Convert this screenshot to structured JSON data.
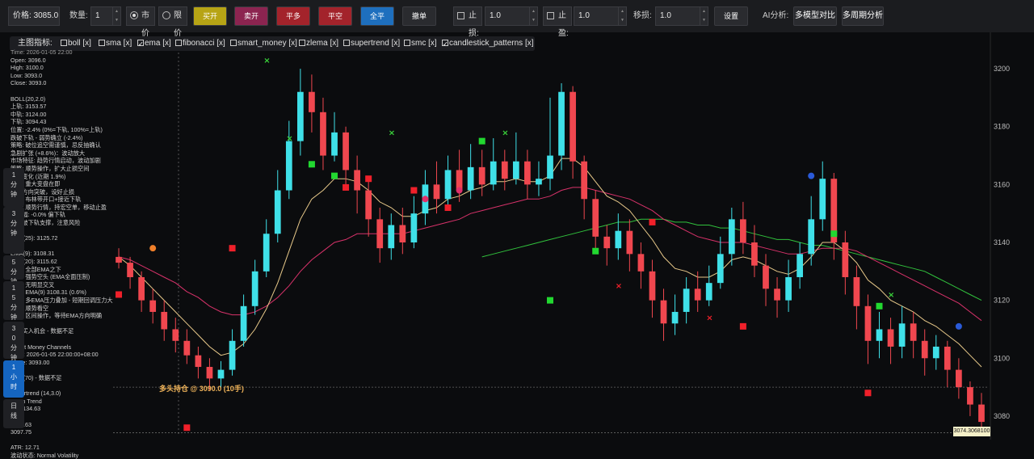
{
  "toolbar": {
    "price_label": "价格:",
    "price_value": "3085.0",
    "qty_label": "数量:",
    "qty_value": "1",
    "market_label": "市价",
    "limit_label": "限价",
    "buy_open": "买开",
    "sell_open": "卖开",
    "close_long": "平多",
    "close_short": "平空",
    "close_all": "全平",
    "withdraw": "撤单",
    "stop_loss_label": "止损:",
    "stop_loss_value": "1.0",
    "take_profit_label": "止盈:",
    "take_profit_value": "1.0",
    "trailing_label": "移损:",
    "trailing_value": "1.0",
    "settings": "设置",
    "ai_label": "AI分析:",
    "multi_model": "多模型对比",
    "multi_period": "多周期分析"
  },
  "colors": {
    "buy": "#b7a415",
    "sell": "#8c2450",
    "close_long": "#a3232b",
    "close_short": "#a3232b",
    "close_all": "#1e6fbe",
    "up": "#3fe0e8",
    "down": "#f0474f"
  },
  "indicators": {
    "title": "主图指标:",
    "items": [
      {
        "label": "boll [x]",
        "checked": false
      },
      {
        "label": "sma [x]",
        "checked": false
      },
      {
        "label": "ema [x]",
        "checked": true
      },
      {
        "label": "fibonacci [x]",
        "checked": false
      },
      {
        "label": "smart_money [x]",
        "checked": false
      },
      {
        "label": "zlema [x]",
        "checked": false
      },
      {
        "label": "supertrend [x]",
        "checked": false
      },
      {
        "label": "smc [x]",
        "checked": false
      },
      {
        "label": "candlestick_patterns [x]",
        "checked": true
      }
    ]
  },
  "info": {
    "lines": [
      "Time: 2026-01-05 22:00",
      "Open: 3096.0",
      "High: 3100.0",
      "Low: 3093.0",
      "Close: 3093.0",
      "",
      "BOLL(20,2.0)",
      "上轨: 3153.57",
      "中轨: 3124.00",
      "下轨: 3094.43",
      "位置: -2.4% (0%=下轨, 100%=上轨)",
      "跌破下轨 - 弱势确立 (-2.4%)",
      "策略: 破位追空需谨慎，忌反抽确认",
      "急剧扩张 (+8.6%)：波动放大",
      "市场特征: 趋势行情启动，波动加剧",
      "策略: 顺势操作，扩大止损空间",
      "带宽变化 (近期 1.9%)",
      "信号: 重大变盘在即",
      "  关注方向突破，设好止损",
      "  观点: 布林带开口+接近下轨",
      "  策略: 顺势行情，持宏空单，移动止盈",
      "  涨跌幅: -0.0% 偏下轨",
      "  偏跌破下轨支撑，注意风险",
      "",
      "EMA(25): 3125.72",
      "",
      "EMA(9): 3108.31",
      "EMA(20): 3115.62",
      "  排列: 全部EMA之下",
      "  趋势: 强势空头 (EMA全面压制)",
      "  交叉: 无明显交叉",
      "  空头: EMA(9) 3108.31 (0.6%)",
      "  观点: 多EMA压力叠加 - 短期回调压力大",
      "  策略: 顺势看空",
      "  建议: 区间操作，等待EMA方向明确",
      "",
      "  回踩买入机会 - 数据不足",
      "",
      "Smart Money Channels",
      "Time: 2026-01-05 22:00:00+08:00",
      "Close: 3093.00",
      "",
      "EMA(70) - 数据不足",
      "",
      "Supertrend (14,3.0)",
      "  Down Trend",
      "  值: 3134.63",
      "",
      "  3134.63",
      "  3097.75",
      "",
      "ATR: 12.71",
      "波动状态: Normal Volatility"
    ]
  },
  "timeframes": [
    {
      "label": "1分钟",
      "active": false
    },
    {
      "label": "3分钟",
      "active": false
    },
    {
      "label": "5分钟",
      "active": false
    },
    {
      "label": "15分钟",
      "active": false
    },
    {
      "label": "30分钟",
      "active": false
    },
    {
      "label": "1小时",
      "active": true
    },
    {
      "label": "日线",
      "active": false
    }
  ],
  "position_note": "多头持仓 @ 3090.0 (10手)",
  "price_tag": "3074.3068100",
  "chart_data": {
    "type": "candlestick",
    "ylim": [
      3073,
      3207
    ],
    "yticks": [
      3080,
      3100,
      3120,
      3140,
      3160,
      3180,
      3200
    ],
    "candles": [
      [
        3135,
        3133,
        3138,
        3131
      ],
      [
        3133,
        3128,
        3135,
        3124
      ],
      [
        3128,
        3120,
        3130,
        3116
      ],
      [
        3120,
        3116,
        3124,
        3112
      ],
      [
        3116,
        3110,
        3120,
        3106
      ],
      [
        3110,
        3106,
        3114,
        3102
      ],
      [
        3106,
        3101,
        3110,
        3098
      ],
      [
        3101,
        3097,
        3104,
        3093
      ],
      [
        3097,
        3093,
        3100,
        3089
      ],
      [
        3093,
        3096,
        3099,
        3090
      ],
      [
        3096,
        3106,
        3110,
        3094
      ],
      [
        3106,
        3118,
        3122,
        3104
      ],
      [
        3118,
        3130,
        3134,
        3115
      ],
      [
        3130,
        3143,
        3148,
        3128
      ],
      [
        3143,
        3158,
        3165,
        3140
      ],
      [
        3158,
        3175,
        3182,
        3155
      ],
      [
        3175,
        3192,
        3200,
        3170
      ],
      [
        3192,
        3185,
        3198,
        3178
      ],
      [
        3185,
        3170,
        3190,
        3165
      ],
      [
        3170,
        3178,
        3185,
        3168
      ],
      [
        3178,
        3165,
        3180,
        3158
      ],
      [
        3165,
        3158,
        3170,
        3150
      ],
      [
        3158,
        3148,
        3163,
        3142
      ],
      [
        3148,
        3138,
        3152,
        3133
      ],
      [
        3138,
        3146,
        3150,
        3134
      ],
      [
        3146,
        3140,
        3152,
        3136
      ],
      [
        3140,
        3150,
        3156,
        3138
      ],
      [
        3150,
        3160,
        3165,
        3146
      ],
      [
        3160,
        3155,
        3168,
        3150
      ],
      [
        3155,
        3165,
        3170,
        3152
      ],
      [
        3165,
        3158,
        3172,
        3154
      ],
      [
        3158,
        3166,
        3174,
        3155
      ],
      [
        3166,
        3160,
        3172,
        3156
      ],
      [
        3160,
        3168,
        3176,
        3158
      ],
      [
        3168,
        3162,
        3172,
        3158
      ],
      [
        3162,
        3168,
        3178,
        3160
      ],
      [
        3168,
        3160,
        3172,
        3155
      ],
      [
        3160,
        3162,
        3168,
        3156
      ],
      [
        3162,
        3170,
        3190,
        3158
      ],
      [
        3170,
        3192,
        3195,
        3165
      ],
      [
        3192,
        3168,
        3194,
        3162
      ],
      [
        3168,
        3155,
        3170,
        3148
      ],
      [
        3155,
        3142,
        3158,
        3136
      ],
      [
        3142,
        3138,
        3146,
        3132
      ],
      [
        3138,
        3144,
        3150,
        3134
      ],
      [
        3144,
        3136,
        3148,
        3130
      ],
      [
        3136,
        3130,
        3140,
        3124
      ],
      [
        3130,
        3120,
        3134,
        3114
      ],
      [
        3120,
        3112,
        3124,
        3106
      ],
      [
        3112,
        3116,
        3122,
        3108
      ],
      [
        3116,
        3124,
        3128,
        3112
      ],
      [
        3124,
        3120,
        3130,
        3116
      ],
      [
        3120,
        3126,
        3132,
        3118
      ],
      [
        3126,
        3136,
        3142,
        3124
      ],
      [
        3136,
        3148,
        3152,
        3132
      ],
      [
        3148,
        3140,
        3154,
        3136
      ],
      [
        3140,
        3132,
        3146,
        3128
      ],
      [
        3132,
        3124,
        3136,
        3118
      ],
      [
        3124,
        3120,
        3128,
        3114
      ],
      [
        3120,
        3128,
        3134,
        3116
      ],
      [
        3128,
        3136,
        3140,
        3124
      ],
      [
        3136,
        3148,
        3156,
        3132
      ],
      [
        3148,
        3162,
        3168,
        3144
      ],
      [
        3162,
        3140,
        3164,
        3134
      ],
      [
        3140,
        3128,
        3144,
        3122
      ],
      [
        3128,
        3118,
        3132,
        3110
      ],
      [
        3118,
        3106,
        3122,
        3098
      ],
      [
        3106,
        3110,
        3116,
        3100
      ],
      [
        3110,
        3104,
        3114,
        3098
      ],
      [
        3104,
        3112,
        3118,
        3100
      ],
      [
        3112,
        3106,
        3116,
        3100
      ],
      [
        3106,
        3100,
        3110,
        3094
      ],
      [
        3100,
        3104,
        3108,
        3096
      ],
      [
        3104,
        3096,
        3106,
        3090
      ],
      [
        3096,
        3090,
        3100,
        3086
      ],
      [
        3090,
        3084,
        3092,
        3080
      ],
      [
        3084,
        3078,
        3088,
        3074
      ]
    ],
    "ema_fast": [
      3135,
      3132,
      3128,
      3124,
      3120,
      3116,
      3112,
      3108,
      3104,
      3101,
      3102,
      3105,
      3110,
      3117,
      3126,
      3137,
      3148,
      3155,
      3158,
      3162,
      3162,
      3161,
      3158,
      3154,
      3152,
      3149,
      3149,
      3151,
      3152,
      3155,
      3156,
      3158,
      3159,
      3161,
      3161,
      3162,
      3161,
      3161,
      3163,
      3169,
      3169,
      3166,
      3161,
      3156,
      3154,
      3151,
      3146,
      3141,
      3135,
      3131,
      3130,
      3128,
      3128,
      3130,
      3134,
      3135,
      3134,
      3132,
      3130,
      3129,
      3131,
      3135,
      3140,
      3140,
      3137,
      3133,
      3127,
      3124,
      3120,
      3118,
      3116,
      3113,
      3111,
      3108,
      3105,
      3101,
      3097
    ],
    "ema_slow": [
      3135,
      3134,
      3132,
      3130,
      3128,
      3126,
      3123,
      3121,
      3118,
      3116,
      3115,
      3115,
      3116,
      3118,
      3121,
      3125,
      3130,
      3134,
      3137,
      3140,
      3141,
      3143,
      3143,
      3143,
      3143,
      3143,
      3144,
      3145,
      3146,
      3147,
      3148,
      3150,
      3151,
      3152,
      3153,
      3154,
      3155,
      3155,
      3156,
      3158,
      3159,
      3159,
      3158,
      3157,
      3156,
      3155,
      3153,
      3151,
      3148,
      3146,
      3144,
      3142,
      3141,
      3140,
      3140,
      3140,
      3139,
      3138,
      3137,
      3136,
      3136,
      3137,
      3138,
      3138,
      3138,
      3137,
      3135,
      3133,
      3131,
      3129,
      3127,
      3125,
      3123,
      3121,
      3119,
      3116,
      3113
    ],
    "ema_long": [
      null,
      null,
      null,
      null,
      null,
      null,
      null,
      null,
      null,
      null,
      null,
      null,
      null,
      null,
      null,
      null,
      null,
      null,
      null,
      null,
      null,
      null,
      null,
      null,
      null,
      null,
      null,
      null,
      null,
      null,
      null,
      null,
      3135,
      3136,
      3137,
      3138,
      3139,
      3140,
      3141,
      3142,
      3143,
      3144,
      3145,
      3146,
      3147,
      3147,
      3148,
      3148,
      3148,
      3147,
      3147,
      3146,
      3146,
      3145,
      3145,
      3144,
      3143,
      3142,
      3141,
      3141,
      3140,
      3139,
      3139,
      3138,
      3137,
      3136,
      3135,
      3134,
      3133,
      3132,
      3131,
      3130,
      3128,
      3126,
      3124,
      3122,
      3120
    ]
  }
}
